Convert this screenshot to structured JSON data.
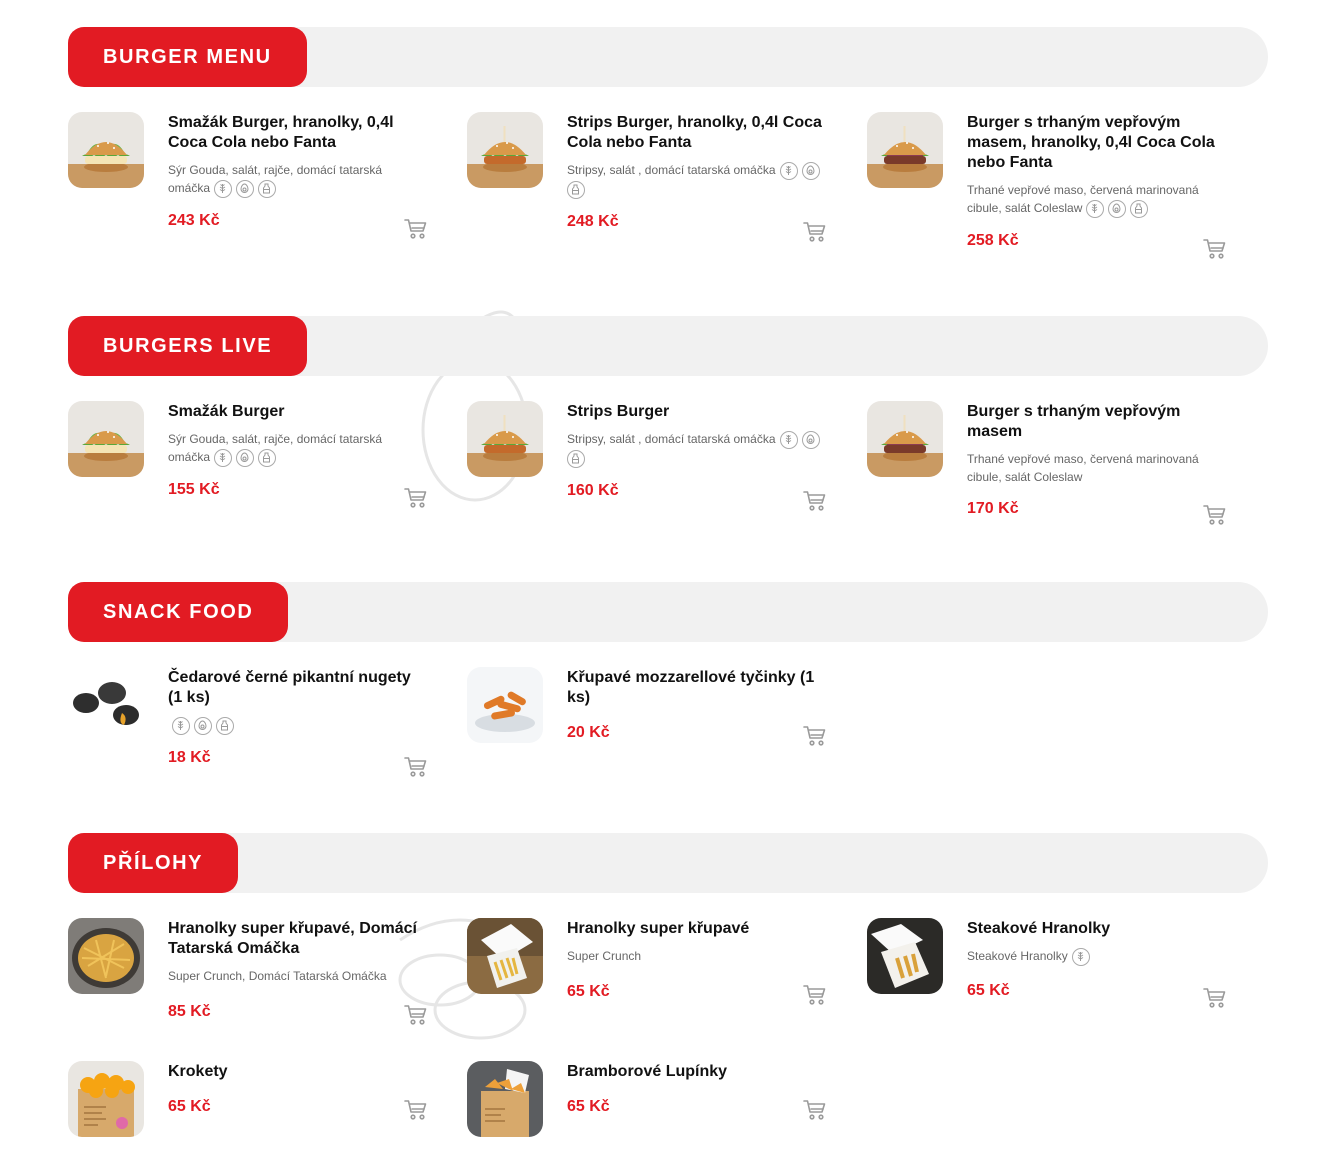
{
  "sections": [
    {
      "title": "BURGER MENU",
      "items": [
        {
          "name": "Smažák Burger, hranolky, 0,4l Coca Cola nebo Fanta",
          "desc": "Sýr Gouda, salát, rajče, domácí tatarská omáčka",
          "price": "243 Kč",
          "allergens": [
            "gluten-icon",
            "egg-icon",
            "milk-icon"
          ],
          "image": "burger-cheese"
        },
        {
          "name": "Strips Burger, hranolky, 0,4l Coca Cola nebo Fanta",
          "desc": "Stripsy, salát , domácí tatarská omáčka",
          "price": "248 Kč",
          "allergens": [
            "gluten-icon",
            "egg-icon",
            "milk-icon"
          ],
          "image": "burger-strips"
        },
        {
          "name": "Burger s trhaným vepřovým masem, hranolky, 0,4l Coca Cola nebo Fanta",
          "desc": "Trhané vepřové maso, červená marinovaná cibule, salát Coleslaw",
          "price": "258 Kč",
          "allergens": [
            "gluten-icon",
            "egg-icon",
            "milk-icon"
          ],
          "image": "burger-pork"
        }
      ]
    },
    {
      "title": "BURGERS LIVE",
      "items": [
        {
          "name": "Smažák Burger",
          "desc": "Sýr Gouda, salát, rajče, domácí tatarská omáčka",
          "price": "155 Kč",
          "allergens": [
            "gluten-icon",
            "egg-icon",
            "milk-icon"
          ],
          "image": "burger-cheese"
        },
        {
          "name": "Strips Burger",
          "desc": "Stripsy, salát , domácí tatarská omáčka",
          "price": "160 Kč",
          "allergens": [
            "gluten-icon",
            "egg-icon",
            "milk-icon"
          ],
          "image": "burger-strips"
        },
        {
          "name": "Burger s trhaným vepřovým masem",
          "desc": "Trhané vepřové maso, červená marinovaná cibule, salát Coleslaw",
          "price": "170 Kč",
          "allergens": [],
          "image": "burger-pork"
        }
      ]
    },
    {
      "title": "SNACK FOOD",
      "items": [
        {
          "name": "Čedarové černé pikantní nugety  (1 ks)",
          "desc": "",
          "price": "18 Kč",
          "allergens": [
            "gluten-icon",
            "egg-icon",
            "milk-icon"
          ],
          "image": "black-nuggets"
        },
        {
          "name": "Křupavé mozzarellové tyčinky  (1 ks)",
          "desc": "",
          "price": "20 Kč",
          "allergens": [],
          "image": "mozzarella-sticks"
        }
      ]
    },
    {
      "title": "PŘÍLOHY",
      "items": [
        {
          "name": "Hranolky super křupavé, Domácí Tatarská Omáčka",
          "desc": "Super Crunch, Domácí Tatarská Omáčka",
          "price": "85 Kč",
          "allergens": [],
          "image": "fries-basket"
        },
        {
          "name": "Hranolky super křupavé",
          "desc": "Super Crunch",
          "price": "65 Kč",
          "allergens": [],
          "image": "fries-box"
        },
        {
          "name": "Steakové Hranolky",
          "desc": "Steakové Hranolky",
          "price": "65 Kč",
          "allergens": [
            "gluten-icon"
          ],
          "image": "steak-fries-box"
        },
        {
          "name": "Krokety",
          "desc": "",
          "price": "65 Kč",
          "allergens": [],
          "image": "croquettes-box"
        },
        {
          "name": "Bramborové Lupínky",
          "desc": "",
          "price": "65 Kč",
          "allergens": [],
          "image": "chips-box"
        }
      ]
    }
  ],
  "colors": {
    "accent": "#e21b23",
    "bar": "#f1f1f1",
    "price": "#e21b23"
  }
}
